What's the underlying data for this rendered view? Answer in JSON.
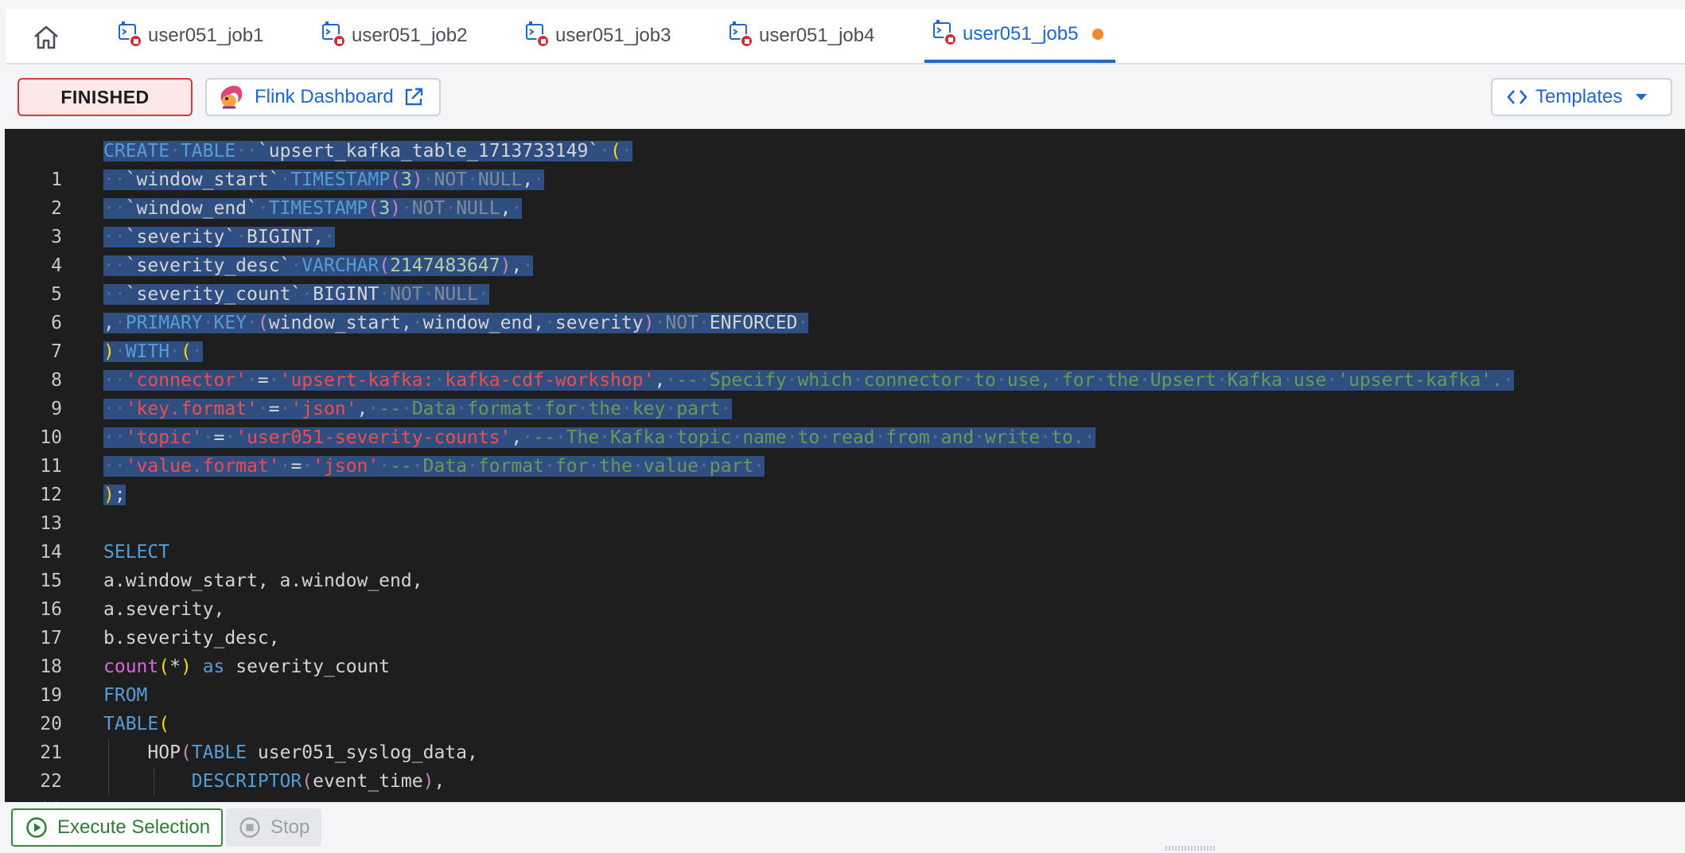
{
  "tabs": {
    "home_icon": "home-icon",
    "items": [
      {
        "label": "user051_job1",
        "icon": "job-stopped-icon",
        "active": false
      },
      {
        "label": "user051_job2",
        "icon": "job-stopped-icon",
        "active": false
      },
      {
        "label": "user051_job3",
        "icon": "job-stopped-icon",
        "active": false
      },
      {
        "label": "user051_job4",
        "icon": "job-stopped-icon",
        "active": false
      },
      {
        "label": "user051_job5",
        "icon": "job-stopped-icon",
        "active": true,
        "unsaved": true
      }
    ]
  },
  "toolbar": {
    "status": "FINISHED",
    "flink_dashboard_label": "Flink Dashboard",
    "flink_icon": "squirrel-logo-icon",
    "external_link_icon": "external-link-icon",
    "templates_label": "Templates",
    "templates_icon": "code-icon",
    "templates_caret": "caret-down-icon"
  },
  "editor": {
    "lines": [
      "CREATE TABLE  `upsert_kafka_table_1713733149` (",
      "  `window_start` TIMESTAMP(3) NOT NULL,",
      "  `window_end` TIMESTAMP(3) NOT NULL,",
      "  `severity` BIGINT,",
      "  `severity_desc` VARCHAR(2147483647),",
      "  `severity_count` BIGINT NOT NULL",
      ", PRIMARY KEY (window_start, window_end, severity) NOT ENFORCED",
      ") WITH (",
      "  'connector' = 'upsert-kafka: kafka-cdf-workshop', -- Specify which connector to use, for the Upsert Kafka use 'upsert-kafka'.",
      "  'key.format' = 'json', -- Data format for the key part",
      "  'topic' = 'user051-severity-counts', -- The Kafka topic name to read from and write to.",
      "  'value.format' = 'json' -- Data format for the value part",
      ");",
      "",
      "SELECT",
      "a.window_start, a.window_end,",
      "a.severity,",
      "b.severity_desc,",
      "count(*) as severity_count",
      "FROM",
      "TABLE(",
      "    HOP(TABLE user051_syslog_data,",
      "        DESCRIPTOR(event_time),"
    ]
  },
  "bottombar": {
    "execute_label": "Execute Selection",
    "execute_icon": "play-circle-icon",
    "stop_label": "Stop",
    "stop_icon": "stop-circle-icon"
  },
  "colors": {
    "accent": "#1f67c9",
    "status_border": "#d9383f",
    "status_bg": "#fde8e8",
    "execute": "#2e8b3e",
    "unsaved_dot": "#f08b2b",
    "selection": "#2f4f82"
  }
}
